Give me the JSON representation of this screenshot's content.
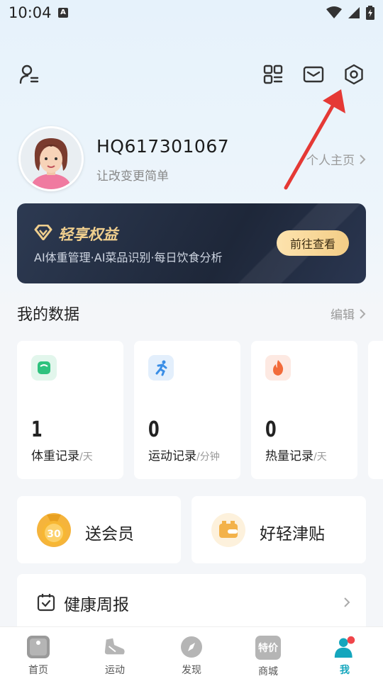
{
  "status_bar": {
    "time": "10:04",
    "notification_letter": "A"
  },
  "profile": {
    "username": "HQ617301067",
    "subtitle": "让改变更简单",
    "home_link": "个人主页"
  },
  "banner": {
    "title": "轻享权益",
    "description": "AI体重管理·AI菜品识别·每日饮食分析",
    "button_label": "前往查看"
  },
  "my_data": {
    "title": "我的数据",
    "edit_label": "编辑",
    "cards": [
      {
        "value": "1",
        "label": "体重记录",
        "unit": "/天",
        "icon": "scale-icon",
        "color": "#2ec27e"
      },
      {
        "value": "0",
        "label": "运动记录",
        "unit": "/分钟",
        "icon": "running-icon",
        "color": "#3a8ee6"
      },
      {
        "value": "0",
        "label": "热量记录",
        "unit": "/天",
        "icon": "flame-icon",
        "color": "#f26b3a"
      }
    ]
  },
  "promos": [
    {
      "label": "送会员",
      "icon": "medal-30-icon",
      "badge": "30"
    },
    {
      "label": "好轻津贴",
      "icon": "wallet-icon"
    }
  ],
  "weekly_report": {
    "label": "健康周报"
  },
  "tabs": [
    {
      "label": "首页",
      "icon": "home-icon"
    },
    {
      "label": "运动",
      "icon": "shoe-icon"
    },
    {
      "label": "发现",
      "icon": "compass-icon"
    },
    {
      "label": "商城",
      "icon": "shop-icon",
      "icon_text": "特价"
    },
    {
      "label": "我",
      "icon": "profile-icon"
    }
  ],
  "colors": {
    "accent": "#14a6bd",
    "gold": "#f0cf8e",
    "annotation_arrow": "#e53935"
  }
}
